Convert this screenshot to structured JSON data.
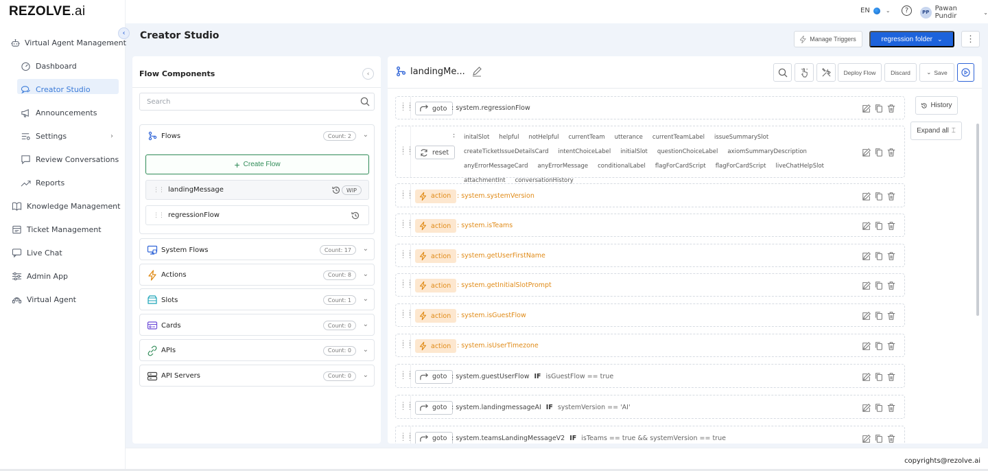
{
  "brand": {
    "logo_main": "REZOLVE",
    "logo_suffix": ".ai"
  },
  "header": {
    "language": "EN",
    "user_initials": "PP",
    "user_name": "Pawan Pundir"
  },
  "sidebar": {
    "items": [
      {
        "label": "Virtual Agent Management",
        "icon": "robot-icon",
        "level": "top",
        "chevron": "down"
      },
      {
        "label": "Dashboard",
        "icon": "gauge-icon",
        "level": "sub"
      },
      {
        "label": "Creator Studio",
        "icon": "chat-icon",
        "level": "sub",
        "active": true
      },
      {
        "label": "Announcements",
        "icon": "megaphone-icon",
        "level": "sub"
      },
      {
        "label": "Settings",
        "icon": "settings-list-icon",
        "level": "sub",
        "chevron": "right"
      },
      {
        "label": "Review Conversations",
        "icon": "message-square-icon",
        "level": "sub"
      },
      {
        "label": "Reports",
        "icon": "trend-icon",
        "level": "sub"
      },
      {
        "label": "Knowledge Management",
        "icon": "book-icon",
        "level": "top",
        "chevron": "right"
      },
      {
        "label": "Ticket Management",
        "icon": "ticket-icon",
        "level": "top"
      },
      {
        "label": "Live Chat",
        "icon": "live-chat-icon",
        "level": "top"
      },
      {
        "label": "Admin App",
        "icon": "sliders-icon",
        "level": "top"
      },
      {
        "label": "Virtual Agent",
        "icon": "agent-icon",
        "level": "top"
      }
    ]
  },
  "studio": {
    "title": "Creator Studio",
    "manage_triggers": "Manage Triggers",
    "folder": "regression folder"
  },
  "flow_components": {
    "title": "Flow Components",
    "search_placeholder": "Search",
    "flows": {
      "label": "Flows",
      "count": "Count: 2",
      "create_label": "Create Flow",
      "items": [
        {
          "name": "landingMessage",
          "badge": "WIP"
        },
        {
          "name": "regressionFlow",
          "badge": ""
        }
      ]
    },
    "sections": [
      {
        "label": "System Flows",
        "count": "Count: 17",
        "icon": "monitor-icon",
        "color": "#2e63d7"
      },
      {
        "label": "Actions",
        "count": "Count: 8",
        "icon": "lightning-icon",
        "color": "#e08a16"
      },
      {
        "label": "Slots",
        "count": "Count: 1",
        "icon": "slots-icon",
        "color": "#1aa3b8"
      },
      {
        "label": "Cards",
        "count": "Count: 0",
        "icon": "card-icon",
        "color": "#6c4bd8"
      },
      {
        "label": "APIs",
        "count": "Count: 0",
        "icon": "api-icon",
        "color": "#2e8a56"
      },
      {
        "label": "API Servers",
        "count": "Count: 0",
        "icon": "server-icon",
        "color": "#444"
      }
    ]
  },
  "canvas": {
    "flow_name": "landingMe...",
    "toolbar": {
      "deploy": "Deploy Flow",
      "discard": "Discard",
      "save": "Save"
    },
    "history": "History",
    "expand_all": "Expand all",
    "steps": [
      {
        "type": "goto",
        "label": "goto",
        "target": ": system.regressionFlow",
        "condition": ""
      },
      {
        "type": "reset",
        "label": "reset",
        "slots": [
          "initalSlot",
          "helpful",
          "notHelpful",
          "currentTeam",
          "utterance",
          "currentTeamLabel",
          "issueSummarySlot",
          "createTicketIssueDetailsCard",
          "intentChoiceLabel",
          "initialSlot",
          "questionChoiceLabel",
          "axiomSummaryDescription",
          "anyErrorMessageCard",
          "anyErrorMessage",
          "conditionalLabel",
          "flagForCardScript",
          "flagForCardScript",
          "liveChatHelpSlot",
          "attachmentInt",
          "conversationHistory"
        ]
      },
      {
        "type": "action",
        "label": "action",
        "target": ": system.systemVersion",
        "condition": ""
      },
      {
        "type": "action",
        "label": "action",
        "target": ": system.isTeams",
        "condition": ""
      },
      {
        "type": "action",
        "label": "action",
        "target": ": system.getUserFirstName",
        "condition": ""
      },
      {
        "type": "action",
        "label": "action",
        "target": ": system.getInitialSlotPrompt",
        "condition": ""
      },
      {
        "type": "action",
        "label": "action",
        "target": ": system.isGuestFlow",
        "condition": ""
      },
      {
        "type": "action",
        "label": "action",
        "target": ": system.isUserTimezone",
        "condition": ""
      },
      {
        "type": "goto",
        "label": "goto",
        "target": ": system.guestUserFlow",
        "keyword": "IF",
        "condition": "isGuestFlow == true"
      },
      {
        "type": "goto",
        "label": "goto",
        "target": ": system.landingmessageAI",
        "keyword": "IF",
        "condition": "systemVersion == 'AI'"
      },
      {
        "type": "goto",
        "label": "goto",
        "target": ": system.teamsLandingMessageV2",
        "keyword": "IF",
        "condition": "isTeams == true && systemVersion == true"
      }
    ]
  },
  "footer": {
    "copyright": "copyrights@rezolve.ai"
  },
  "colors": {
    "primary": "#1d63dc",
    "action": "#e08a16",
    "create": "#2e8a56",
    "active_nav": "#3b7bd8"
  }
}
